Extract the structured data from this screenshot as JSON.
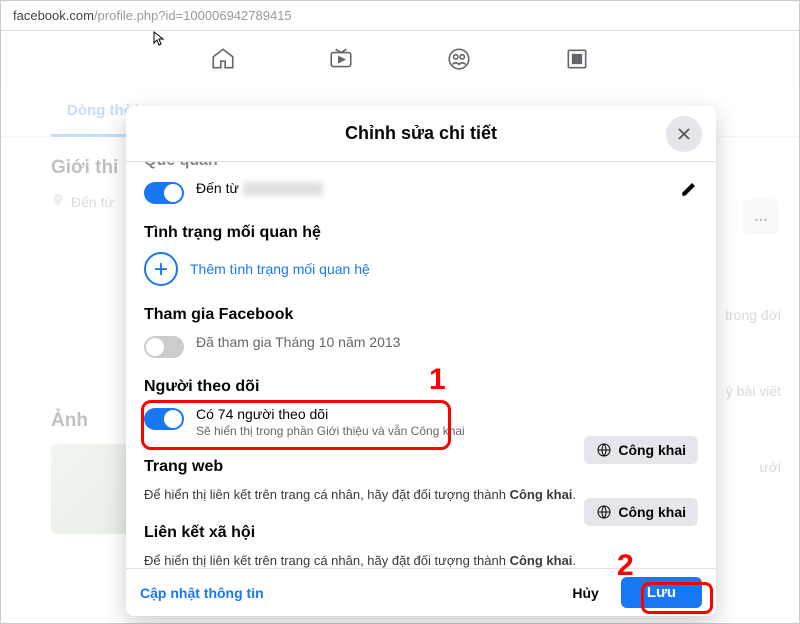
{
  "url": {
    "host": "facebook.com",
    "path": "/profile.php?id=100006942789415"
  },
  "tabs": {
    "timeline": "Dòng thời"
  },
  "intro": {
    "heading": "Giới thi",
    "from": "Đến từ"
  },
  "photos": {
    "heading": "Ảnh"
  },
  "right_hints": {
    "a": "trong đời",
    "b": "ý bài viết",
    "c": "ưới"
  },
  "more": "...",
  "modal": {
    "title": "Chỉnh sửa chi tiết",
    "section_hometown": {
      "title": "Quê quán",
      "label": "Đến từ"
    },
    "section_relationship": {
      "title": "Tình trạng mối quan hệ",
      "add": "Thêm tình trạng mối quan hệ"
    },
    "section_joined": {
      "title": "Tham gia Facebook",
      "label": "Đã tham gia Tháng 10 năm 2013"
    },
    "section_followers": {
      "title": "Người theo dõi",
      "label": "Có 74 người theo dõi",
      "sublabel": "Sẽ hiển thị trong phần Giới thiệu và vẫn Công khai"
    },
    "section_website": {
      "title": "Trang web",
      "desc_prefix": "Để hiển thị liên kết trên trang cá nhân, hãy đặt đối tượng thành ",
      "desc_bold": "Công khai",
      "desc_suffix": "."
    },
    "section_social": {
      "title": "Liên kết xã hội",
      "desc_prefix": "Để hiển thị liên kết trên trang cá nhân, hãy đặt đối tượng thành ",
      "desc_bold": "Công khai",
      "desc_suffix": "."
    },
    "public_label": "Công khai",
    "footer": {
      "update": "Cập nhật thông tin",
      "cancel": "Hủy",
      "save": "Lưu"
    }
  },
  "annotations": {
    "one": "1",
    "two": "2"
  }
}
